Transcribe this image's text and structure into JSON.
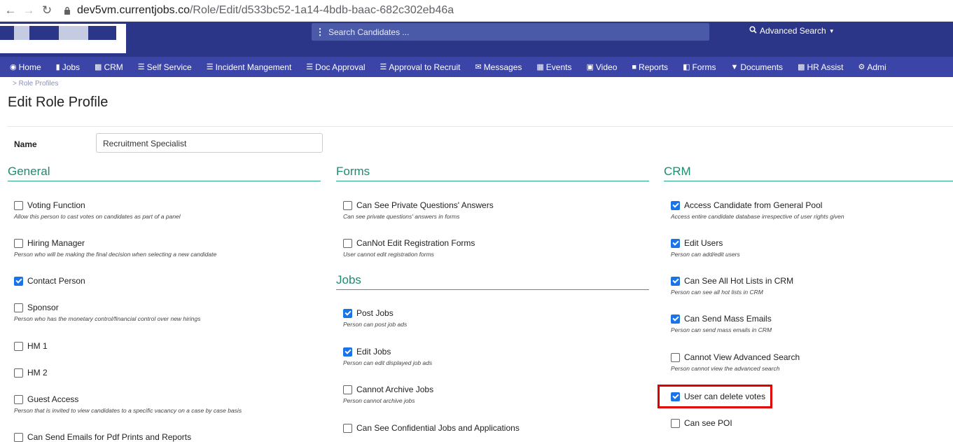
{
  "browser": {
    "url_domain": "dev5vm.currentjobs.co",
    "url_path": "/Role/Edit/d533bc52-1a14-4bdb-baac-682c302eb46a"
  },
  "header": {
    "search_placeholder": "Search Candidates ...",
    "advanced_search_label": "Advanced Search"
  },
  "nav": {
    "items": [
      {
        "label": "Home",
        "icon": "home-icon"
      },
      {
        "label": "Jobs",
        "icon": "folder-icon"
      },
      {
        "label": "CRM",
        "icon": "briefcase-icon"
      },
      {
        "label": "Self Service",
        "icon": "list-icon"
      },
      {
        "label": "Incident Mangement",
        "icon": "list-icon"
      },
      {
        "label": "Doc Approval",
        "icon": "list-icon"
      },
      {
        "label": "Approval to Recruit",
        "icon": "list-icon"
      },
      {
        "label": "Messages",
        "icon": "envelope-icon"
      },
      {
        "label": "Events",
        "icon": "calendar-icon"
      },
      {
        "label": "Video",
        "icon": "video-icon"
      },
      {
        "label": "Reports",
        "icon": "report-icon"
      },
      {
        "label": "Forms",
        "icon": "document-icon"
      },
      {
        "label": "Documents",
        "icon": "filter-icon"
      },
      {
        "label": "HR Assist",
        "icon": "briefcase-icon"
      },
      {
        "label": "Admi",
        "icon": "gear-icon"
      }
    ]
  },
  "page": {
    "breadcrumb": "Role Profiles",
    "title": "Edit Role Profile",
    "name_label": "Name",
    "name_value": "Recruitment Specialist"
  },
  "sections": {
    "general": {
      "title": "General",
      "items": [
        {
          "label": "Voting Function",
          "desc": "Allow this person to cast votes on candidates as part of a panel",
          "checked": false
        },
        {
          "label": "Hiring Manager",
          "desc": "Person who will be making the final decision when selecting a new candidate",
          "checked": false
        },
        {
          "label": "Contact Person",
          "desc": "",
          "checked": true
        },
        {
          "label": "Sponsor",
          "desc": "Person who has the monetary control/financial control over new hirings",
          "checked": false
        },
        {
          "label": "HM 1",
          "desc": "",
          "checked": false
        },
        {
          "label": "HM 2",
          "desc": "",
          "checked": false
        },
        {
          "label": "Guest Access",
          "desc": "Person that is invited to view candidates to a specific vacancy on a case by case basis",
          "checked": false
        },
        {
          "label": "Can Send Emails for Pdf Prints and Reports",
          "desc": "",
          "checked": false
        }
      ]
    },
    "forms": {
      "title": "Forms",
      "items": [
        {
          "label": "Can See Private Questions' Answers",
          "desc": "Can see private questions' answers in forms",
          "checked": false
        },
        {
          "label": "CanNot Edit Registration Forms",
          "desc": "User cannot edit registration forms",
          "checked": false
        }
      ]
    },
    "jobs": {
      "title": "Jobs",
      "items": [
        {
          "label": "Post Jobs",
          "desc": "Person can post job ads",
          "checked": true
        },
        {
          "label": "Edit Jobs",
          "desc": "Person can edit displayed job ads",
          "checked": true
        },
        {
          "label": "Cannot Archive Jobs",
          "desc": "Person cannot archive jobs",
          "checked": false
        },
        {
          "label": "Can See Confidential Jobs and Applications",
          "desc": "",
          "checked": false
        }
      ]
    },
    "crm": {
      "title": "CRM",
      "items": [
        {
          "label": "Access Candidate from General Pool",
          "desc": "Access entire candidate database irrespective of user rights given",
          "checked": true
        },
        {
          "label": "Edit Users",
          "desc": "Person can add/edit users",
          "checked": true
        },
        {
          "label": "Can See All Hot Lists in CRM",
          "desc": "Person can see all hot lists in CRM",
          "checked": true
        },
        {
          "label": "Can Send Mass Emails",
          "desc": "Person can send mass emails in CRM",
          "checked": true
        },
        {
          "label": "Cannot View Advanced Search",
          "desc": "Person cannot view the advanced search",
          "checked": false
        },
        {
          "label": "User can delete votes",
          "desc": "",
          "checked": true
        },
        {
          "label": "Can see POI",
          "desc": "",
          "checked": false
        }
      ]
    }
  }
}
